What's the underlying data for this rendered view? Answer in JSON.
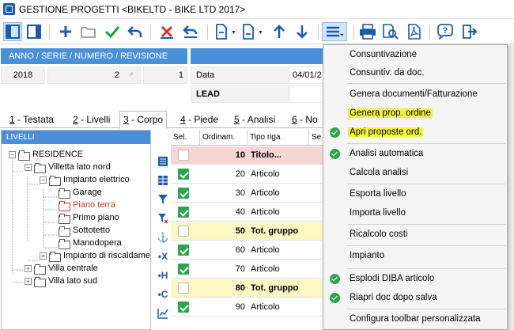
{
  "window": {
    "title": "GESTIONE PROGETTI <BIKELTD - BIKE LTD 2017>"
  },
  "colors": {
    "accent": "#4a90d9",
    "highlight": "#f2f53c",
    "check": "#2ea44f",
    "pink_row": "#f8d5d5",
    "yellow_row": "#fbf8c4"
  },
  "toolbar": {
    "icons": [
      "panel-left-icon",
      "panel-icon",
      "add-icon",
      "open-folder-icon",
      "confirm-check-icon",
      "undo-icon",
      "delete-icon",
      "revert-icon",
      "new-document-icon",
      "document-icon",
      "arrow-up-icon",
      "arrow-down-icon",
      "menu-icon",
      "print-icon",
      "print-preview-icon",
      "pdf-icon",
      "help-icon",
      "exit-icon"
    ]
  },
  "header": {
    "band_label": "ANNO / SERIE / NUMERO / REVISIONE",
    "year": "2018",
    "number": "2",
    "revision": "1",
    "date_label": "Data",
    "date_value": "04/01/2",
    "lead_label": "LEAD"
  },
  "tabs": [
    {
      "num": "1",
      "label": " - Testata"
    },
    {
      "num": "2",
      "label": " - Livelli"
    },
    {
      "num": "3",
      "label": " - Corpo"
    },
    {
      "num": "4",
      "label": " - Piede"
    },
    {
      "num": "5",
      "label": " - Analisi"
    },
    {
      "num": "6",
      "label": " - No"
    }
  ],
  "tree": {
    "header": "LIVELLI",
    "nodes": [
      {
        "label": "RESIDENCE"
      },
      {
        "label": "Villetta lato nord"
      },
      {
        "label": "Impianto elettrico"
      },
      {
        "label": "Garage"
      },
      {
        "label": "Piano terra"
      },
      {
        "label": "Primo piano"
      },
      {
        "label": "Sottotetto"
      },
      {
        "label": "Manodopera"
      },
      {
        "label": "Impianto di riscaldame"
      },
      {
        "label": "Villa centrale"
      },
      {
        "label": "Villa lato sud"
      }
    ]
  },
  "grid": {
    "columns": [
      "Sel.",
      "Ordinam.",
      "Tipo riga",
      "Se"
    ],
    "rows": [
      {
        "checked": false,
        "order": "10",
        "type": "Titolo...",
        "style": "pink"
      },
      {
        "checked": true,
        "order": "20",
        "type": "Articolo",
        "style": "white"
      },
      {
        "checked": true,
        "order": "30",
        "type": "Articolo",
        "style": "white"
      },
      {
        "checked": true,
        "order": "40",
        "type": "Articolo",
        "style": "white"
      },
      {
        "checked": false,
        "order": "50",
        "type": "Tot. gruppo",
        "style": "yellow"
      },
      {
        "checked": true,
        "order": "60",
        "type": "Articolo",
        "style": "white"
      },
      {
        "checked": true,
        "order": "70",
        "type": "Articolo",
        "style": "white"
      },
      {
        "checked": false,
        "order": "80",
        "type": "Tot. gruppo",
        "style": "yellow"
      },
      {
        "checked": true,
        "order": "90",
        "type": "Articolo",
        "style": "white"
      }
    ]
  },
  "menu": {
    "items": [
      {
        "label": "Consuntivazione",
        "checked": false,
        "highlighted": false
      },
      {
        "label": "Consuntiv. da doc.",
        "checked": false,
        "highlighted": false
      },
      {
        "label": "Genera documenti/Fatturazione",
        "checked": false,
        "highlighted": false
      },
      {
        "label": "Genera prop. ordine",
        "checked": false,
        "highlighted": true
      },
      {
        "label": "Apri proposte ord.",
        "checked": true,
        "highlighted": true
      },
      {
        "label": "Analisi automatica",
        "checked": true,
        "highlighted": false
      },
      {
        "label": "Calcola analisi",
        "checked": false,
        "highlighted": false
      },
      {
        "label": "Esporta livello",
        "checked": false,
        "highlighted": false
      },
      {
        "label": "Importa livello",
        "checked": false,
        "highlighted": false
      },
      {
        "label": "Ricalcolo costi",
        "checked": false,
        "highlighted": false
      },
      {
        "label": "Impianto",
        "checked": false,
        "highlighted": false
      },
      {
        "label": "Esplodi DIBA articolo",
        "checked": true,
        "highlighted": false
      },
      {
        "label": "Riapri doc dopo salva",
        "checked": true,
        "highlighted": false
      },
      {
        "label": "Configura toolbar personalizzata",
        "checked": false,
        "highlighted": false
      }
    ]
  }
}
